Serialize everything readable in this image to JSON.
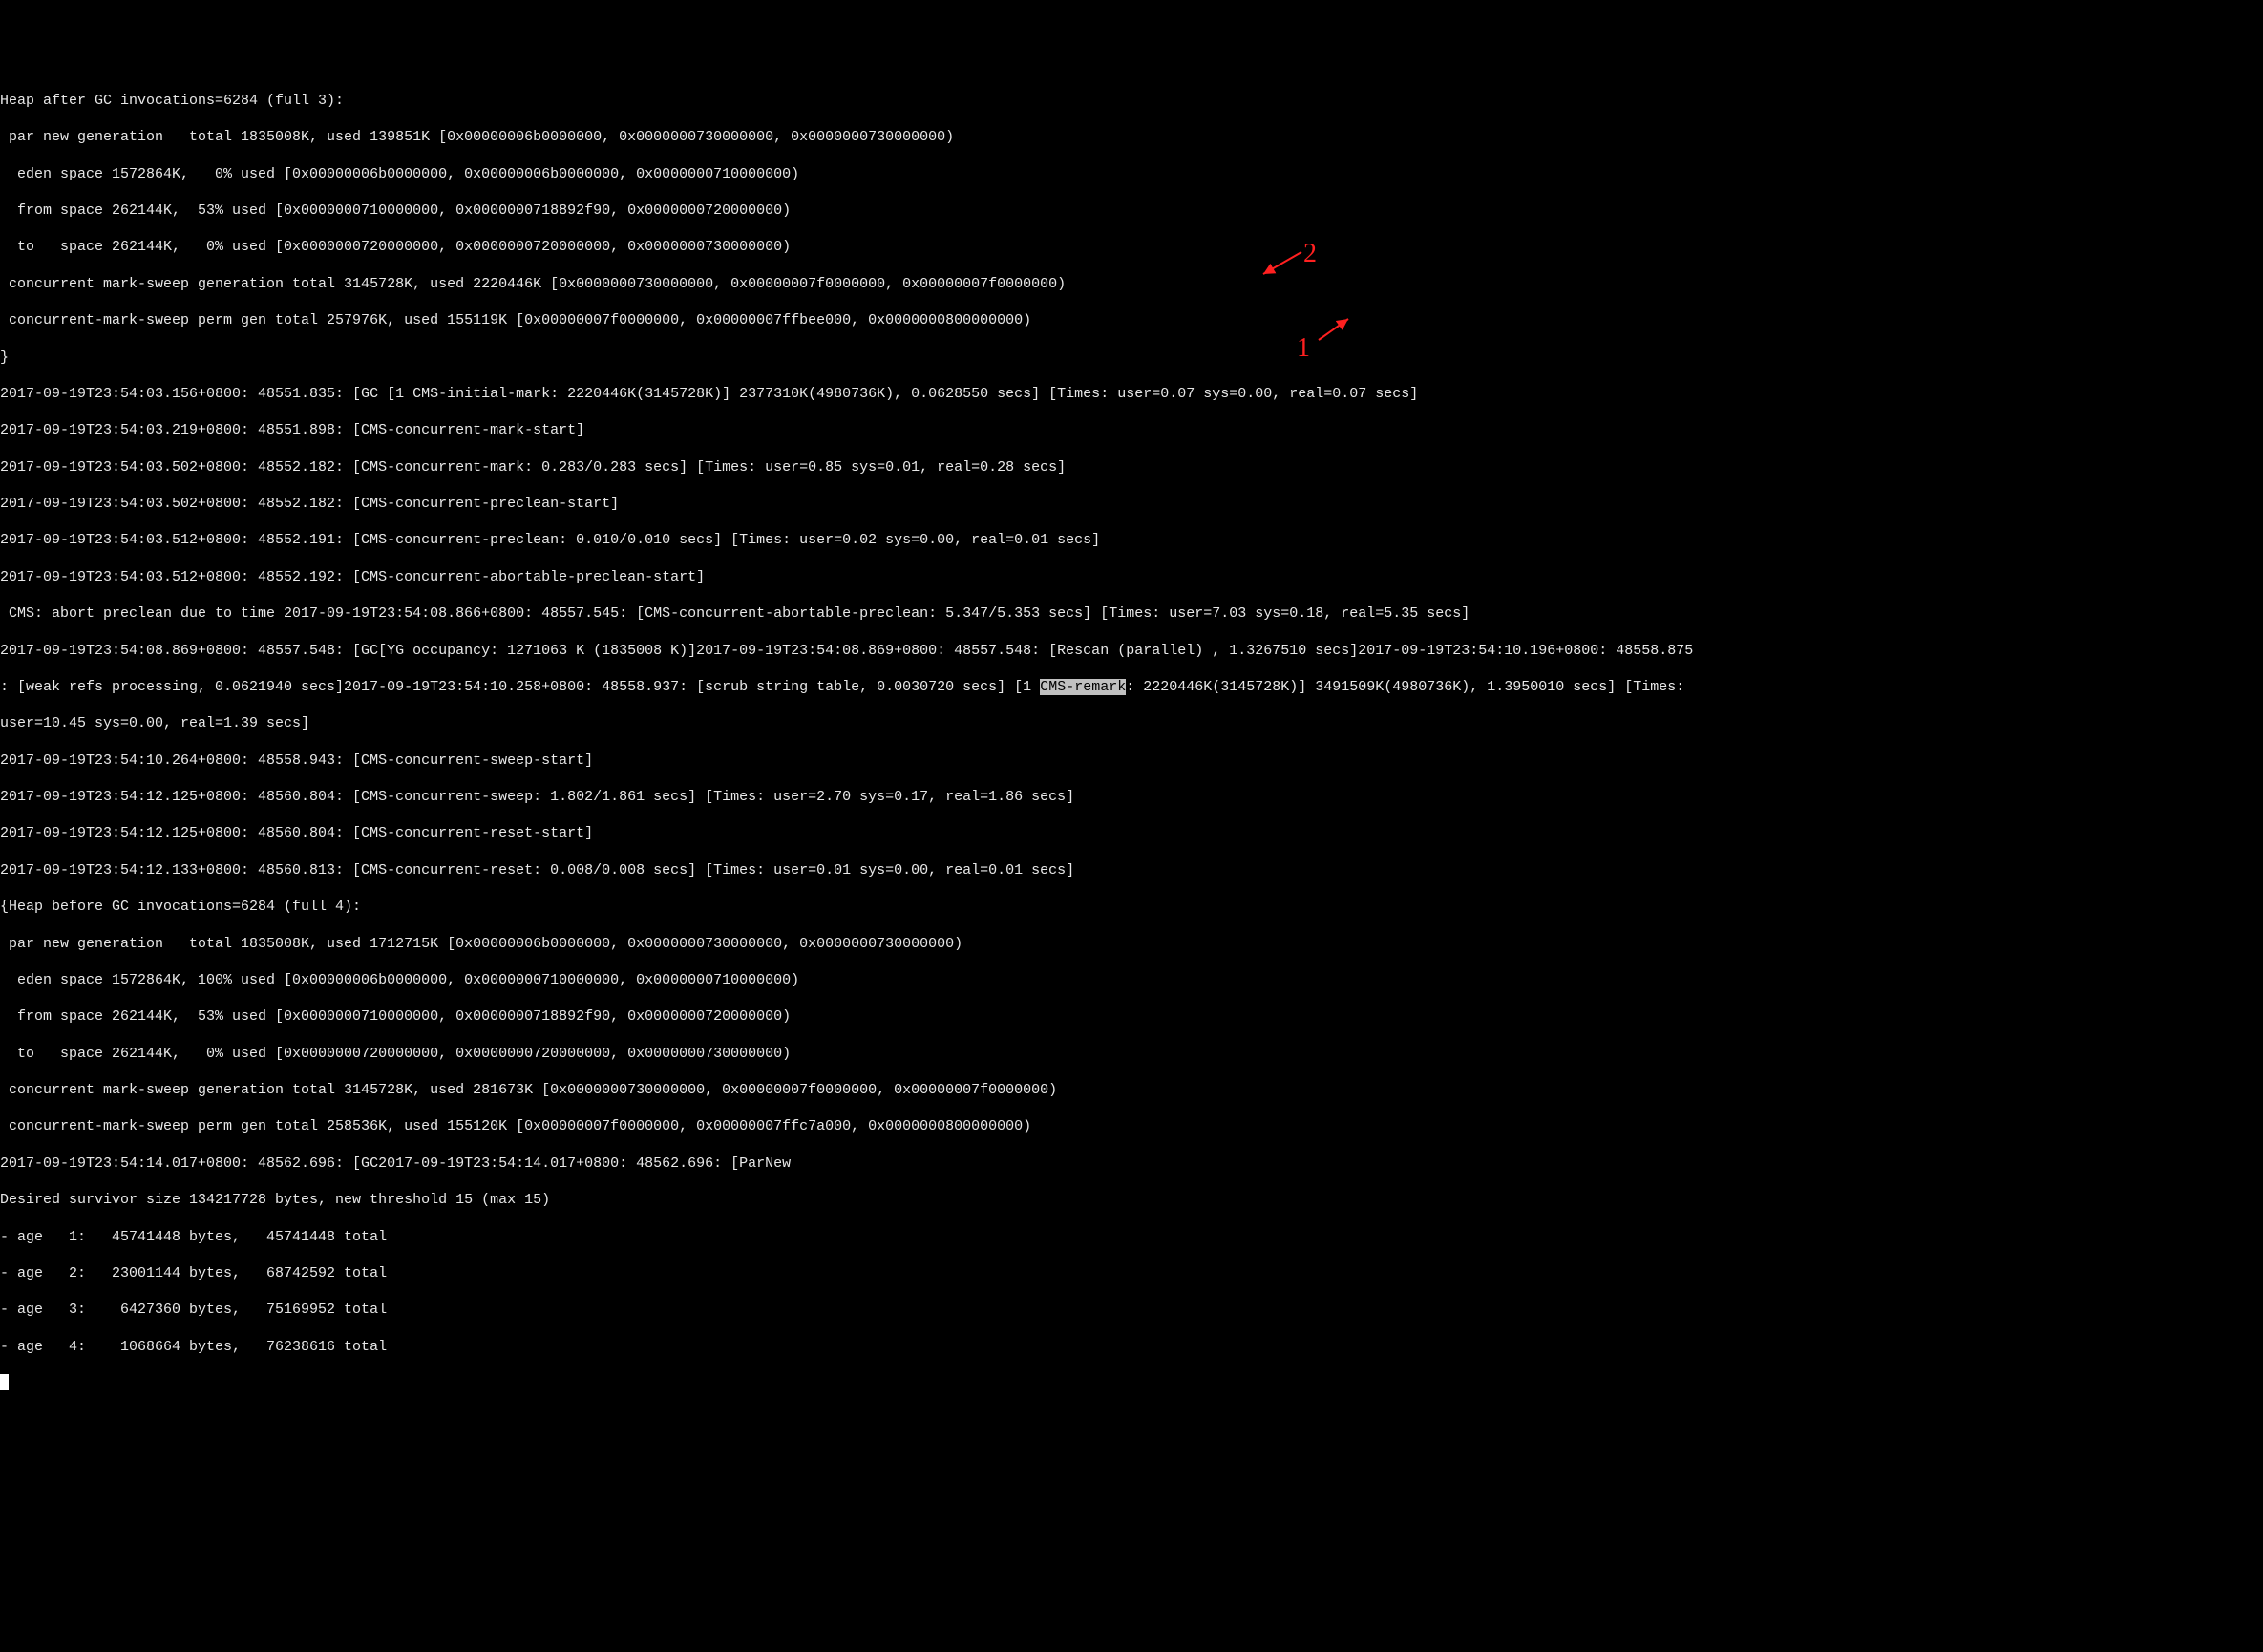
{
  "lines": [
    "Heap after GC invocations=6284 (full 3):",
    " par new generation   total 1835008K, used 139851K [0x00000006b0000000, 0x0000000730000000, 0x0000000730000000)",
    "  eden space 1572864K,   0% used [0x00000006b0000000, 0x00000006b0000000, 0x0000000710000000)",
    "  from space 262144K,  53% used [0x0000000710000000, 0x0000000718892f90, 0x0000000720000000)",
    "  to   space 262144K,   0% used [0x0000000720000000, 0x0000000720000000, 0x0000000730000000)",
    " concurrent mark-sweep generation total 3145728K, used 2220446K [0x0000000730000000, 0x00000007f0000000, 0x00000007f0000000)",
    " concurrent-mark-sweep perm gen total 257976K, used 155119K [0x00000007f0000000, 0x00000007ffbee000, 0x0000000800000000)",
    "}",
    "2017-09-19T23:54:03.156+0800: 48551.835: [GC [1 CMS-initial-mark: 2220446K(3145728K)] 2377310K(4980736K), 0.0628550 secs] [Times: user=0.07 sys=0.00, real=0.07 secs]",
    "2017-09-19T23:54:03.219+0800: 48551.898: [CMS-concurrent-mark-start]",
    "2017-09-19T23:54:03.502+0800: 48552.182: [CMS-concurrent-mark: 0.283/0.283 secs] [Times: user=0.85 sys=0.01, real=0.28 secs]",
    "2017-09-19T23:54:03.502+0800: 48552.182: [CMS-concurrent-preclean-start]",
    "2017-09-19T23:54:03.512+0800: 48552.191: [CMS-concurrent-preclean: 0.010/0.010 secs] [Times: user=0.02 sys=0.00, real=0.01 secs]",
    "2017-09-19T23:54:03.512+0800: 48552.192: [CMS-concurrent-abortable-preclean-start]",
    " CMS: abort preclean due to time 2017-09-19T23:54:08.866+0800: 48557.545: [CMS-concurrent-abortable-preclean: 5.347/5.353 secs] [Times: user=7.03 sys=0.18, real=5.35 secs]",
    "2017-09-19T23:54:08.869+0800: 48557.548: [GC[YG occupancy: 1271063 K (1835008 K)]2017-09-19T23:54:08.869+0800: 48557.548: [Rescan (parallel) , 1.3267510 secs]2017-09-19T23:54:10.196+0800: 48558.875",
    ": [weak refs processing, 0.0621940 secs]2017-09-19T23:54:10.258+0800: 48558.937: [scrub string table, 0.0030720 secs] [1 ",
    "user=10.45 sys=0.00, real=1.39 secs]",
    "2017-09-19T23:54:10.264+0800: 48558.943: [CMS-concurrent-sweep-start]",
    "2017-09-19T23:54:12.125+0800: 48560.804: [CMS-concurrent-sweep: 1.802/1.861 secs] [Times: user=2.70 sys=0.17, real=1.86 secs]",
    "2017-09-19T23:54:12.125+0800: 48560.804: [CMS-concurrent-reset-start]",
    "2017-09-19T23:54:12.133+0800: 48560.813: [CMS-concurrent-reset: 0.008/0.008 secs] [Times: user=0.01 sys=0.00, real=0.01 secs]",
    "{Heap before GC invocations=6284 (full 4):",
    " par new generation   total 1835008K, used 1712715K [0x00000006b0000000, 0x0000000730000000, 0x0000000730000000)",
    "  eden space 1572864K, 100% used [0x00000006b0000000, 0x0000000710000000, 0x0000000710000000)",
    "  from space 262144K,  53% used [0x0000000710000000, 0x0000000718892f90, 0x0000000720000000)",
    "  to   space 262144K,   0% used [0x0000000720000000, 0x0000000720000000, 0x0000000730000000)",
    " concurrent mark-sweep generation total 3145728K, used 281673K [0x0000000730000000, 0x00000007f0000000, 0x00000007f0000000)",
    " concurrent-mark-sweep perm gen total 258536K, used 155120K [0x00000007f0000000, 0x00000007ffc7a000, 0x0000000800000000)",
    "2017-09-19T23:54:14.017+0800: 48562.696: [GC2017-09-19T23:54:14.017+0800: 48562.696: [ParNew",
    "Desired survivor size 134217728 bytes, new threshold 15 (max 15)",
    "- age   1:   45741448 bytes,   45741448 total",
    "- age   2:   23001144 bytes,   68742592 total",
    "- age   3:    6427360 bytes,   75169952 total",
    "- age   4:    1068664 bytes,   76238616 total"
  ],
  "highlighted": {
    "text": "CMS-remark",
    "after": ": 2220446K(3145728K)] 3491509K(4980736K), 1.3950010 secs] [Times: "
  },
  "annotations": {
    "label1": "1",
    "label2": "2"
  }
}
